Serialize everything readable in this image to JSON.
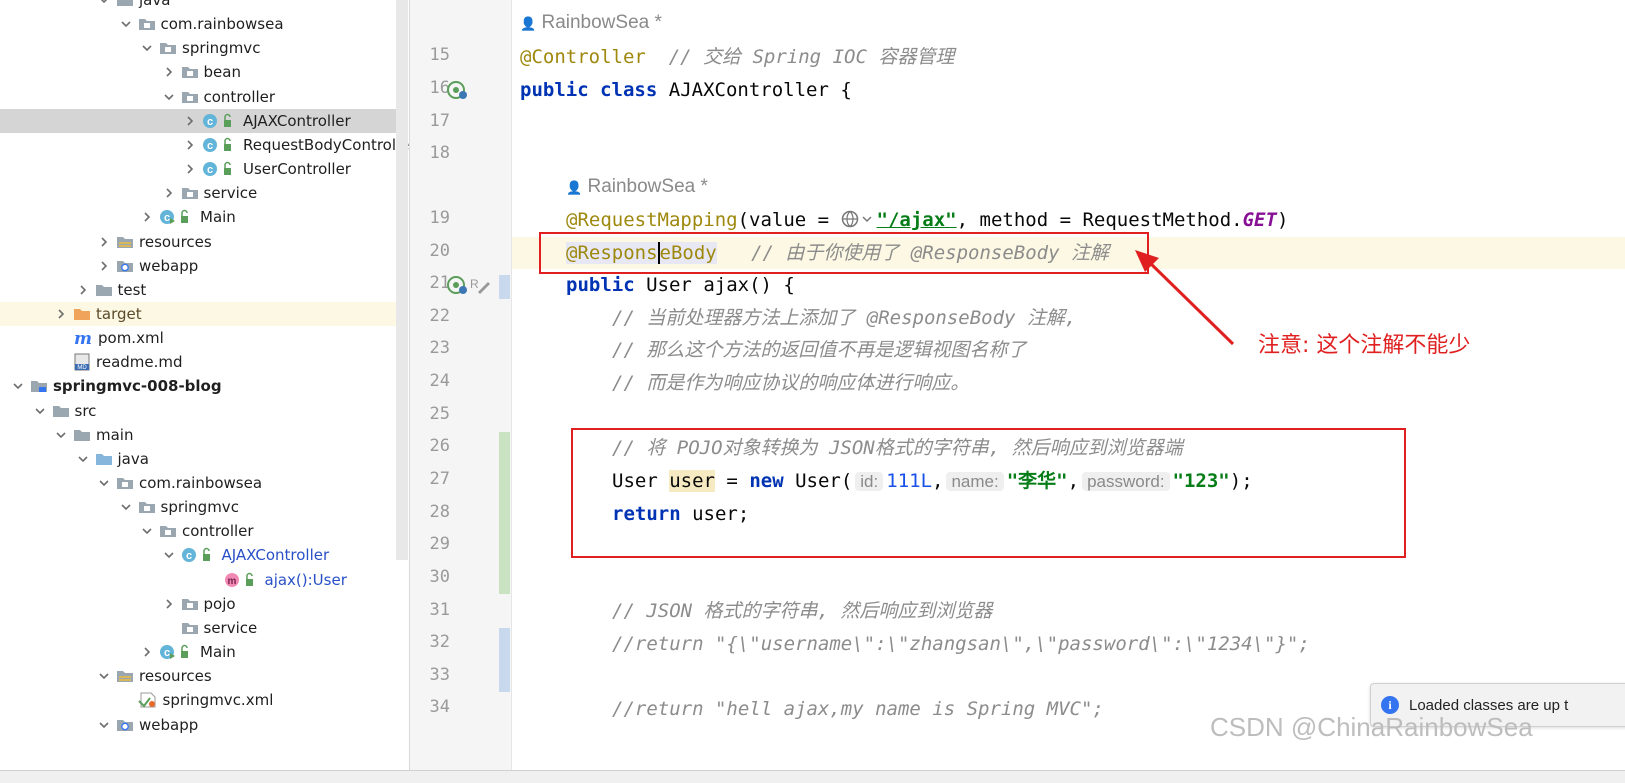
{
  "project_tree": [
    {
      "label": "java",
      "icon": "folder-icon",
      "arrow": "down"
    },
    {
      "label": "com.rainbowsea",
      "icon": "package-icon",
      "arrow": "down"
    },
    {
      "label": "springmvc",
      "icon": "package-icon",
      "arrow": "down"
    },
    {
      "label": "bean",
      "icon": "package-icon",
      "arrow": "right"
    },
    {
      "label": "controller",
      "icon": "package-icon",
      "arrow": "down"
    },
    {
      "label": "AJAXController",
      "icon": "class-icon",
      "arrow": "right",
      "selected": true
    },
    {
      "label": "RequestBodyController",
      "icon": "class-icon",
      "arrow": "right"
    },
    {
      "label": "UserController",
      "icon": "class-icon",
      "arrow": "right"
    },
    {
      "label": "service",
      "icon": "package-icon",
      "arrow": "right"
    },
    {
      "label": "Main",
      "icon": "main-class-icon",
      "arrow": "right"
    },
    {
      "label": "resources",
      "icon": "resources-folder-icon",
      "arrow": "right"
    },
    {
      "label": "webapp",
      "icon": "web-folder-icon",
      "arrow": "right"
    },
    {
      "label": "test",
      "icon": "folder-icon",
      "arrow": "right"
    },
    {
      "label": "target",
      "icon": "target-folder-icon",
      "arrow": "right",
      "highlight": true
    },
    {
      "label": "pom.xml",
      "icon": "maven-icon",
      "arrow": "none"
    },
    {
      "label": "readme.md",
      "icon": "markdown-icon",
      "arrow": "none"
    },
    {
      "label": "springmvc-008-blog",
      "icon": "module-icon",
      "arrow": "down",
      "bold": true
    },
    {
      "label": "src",
      "icon": "folder-icon",
      "arrow": "down"
    },
    {
      "label": "main",
      "icon": "folder-icon",
      "arrow": "down"
    },
    {
      "label": "java",
      "icon": "source-folder-icon",
      "arrow": "down"
    },
    {
      "label": "com.rainbowsea",
      "icon": "package-icon",
      "arrow": "down"
    },
    {
      "label": "springmvc",
      "icon": "package-icon",
      "arrow": "down"
    },
    {
      "label": "controller",
      "icon": "package-icon",
      "arrow": "down"
    },
    {
      "label": "AJAXController",
      "icon": "class-icon",
      "arrow": "down",
      "blue": true
    },
    {
      "label": "ajax():User",
      "icon": "method-icon",
      "arrow": "none",
      "blue": true
    },
    {
      "label": "pojo",
      "icon": "package-icon",
      "arrow": "right"
    },
    {
      "label": "service",
      "icon": "package-icon",
      "arrow": "none"
    },
    {
      "label": "Main",
      "icon": "main-class-icon",
      "arrow": "right"
    },
    {
      "label": "resources",
      "icon": "resources-folder-icon",
      "arrow": "down"
    },
    {
      "label": "springmvc.xml",
      "icon": "spring-xml-icon",
      "arrow": "none"
    },
    {
      "label": "webapp",
      "icon": "web-folder-icon",
      "arrow": "down"
    }
  ],
  "line_numbers": [
    "15",
    "16",
    "17",
    "18",
    "19",
    "20",
    "21",
    "22",
    "23",
    "24",
    "25",
    "26",
    "27",
    "28",
    "29",
    "30",
    "31",
    "32",
    "33",
    "34"
  ],
  "editor": {
    "author_top": "RainbowSea *",
    "author_method": "RainbowSea *",
    "controller_ann": "@Controller",
    "controller_comment": "// 交给 Spring IOC 容器管理",
    "kw_public": "public",
    "kw_class": "class",
    "class_name": "AJAXController {",
    "rm_ann": "@RequestMapping",
    "rm_open": "(value = ",
    "rm_path": "\"/ajax\"",
    "rm_method": ", method = RequestMethod.",
    "rm_get": "GET",
    "rm_close": ")",
    "rb_ann_a": "@Respons",
    "rb_ann_b": "e",
    "rb_ann_c": "Body",
    "rb_comment": "// 由于你使用了 @ResponseBody 注解",
    "sig_type": "User",
    "sig_name": "ajax() {",
    "c22": "// 当前处理器方法上添加了 @ResponseBody 注解,",
    "c23": "// 那么这个方法的返回值不再是逻辑视图名称了",
    "c24": "// 而是作为响应协议的响应体进行响应。",
    "c26": "// 将 POJO对象转换为 JSON格式的字符串, 然后响应到浏览器端",
    "l27_type": "User",
    "l27_var": "user",
    "l27_eq": " = ",
    "kw_new": "new",
    "l27_ctor": " User(",
    "hint_id": "id:",
    "val_id": "111L",
    "hint_name": "name:",
    "val_name": "\"李华\"",
    "hint_password": "password:",
    "val_password": "\"123\"",
    "l27_end": ");",
    "kw_return": "return",
    "l28_rest": " user;",
    "c31": "// JSON 格式的字符串, 然后响应到浏览器",
    "c32": "//return \"{\\\"username\\\":\\\"zhangsan\\\",\\\"password\\\":\\\"1234\\\"}\";",
    "c34": "//return \"hell ajax,my name is Spring MVC\";"
  },
  "annotation_note": "注意: 这个注解不能少",
  "toast_text": "Loaded classes are up t",
  "watermark": "CSDN @ChinaRainbowSea",
  "colors": {
    "annotation": "#9e880d",
    "keyword": "#0033b3",
    "string": "#067d17",
    "comment": "#8c8c8c",
    "red_mark": "#e02020",
    "selected_row": "#d5d5d5"
  }
}
